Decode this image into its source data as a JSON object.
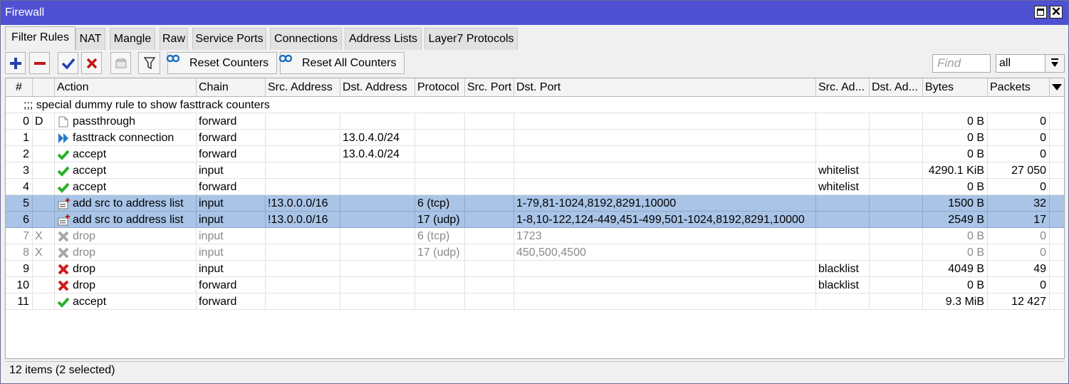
{
  "window": {
    "title": "Firewall"
  },
  "tabs": [
    "Filter Rules",
    "NAT",
    "Mangle",
    "Raw",
    "Service Ports",
    "Connections",
    "Address Lists",
    "Layer7 Protocols"
  ],
  "toolbar": {
    "reset_counters": "Reset Counters",
    "reset_all_counters": "Reset All Counters",
    "find_placeholder": "Find",
    "filter_value": "all"
  },
  "columns": [
    "#",
    "",
    "Action",
    "Chain",
    "Src. Address",
    "Dst. Address",
    "Protocol",
    "Src. Port",
    "Dst. Port",
    "Src. Ad...",
    "Dst. Ad...",
    "Bytes",
    "Packets"
  ],
  "comment": ";;; special dummy rule to show fasttrack counters",
  "rows": [
    {
      "num": "0",
      "flag": "D",
      "icon": "passthrough-icon",
      "action": "passthrough",
      "chain": "forward",
      "src": "",
      "dst": "",
      "proto": "",
      "sport": "",
      "dport": "",
      "srclist": "",
      "dstlist": "",
      "bytes": "0 B",
      "packets": "0",
      "state": "normal"
    },
    {
      "num": "1",
      "flag": "",
      "icon": "fasttrack-icon",
      "action": "fasttrack connection",
      "chain": "forward",
      "src": "",
      "dst": "13.0.4.0/24",
      "proto": "",
      "sport": "",
      "dport": "",
      "srclist": "",
      "dstlist": "",
      "bytes": "0 B",
      "packets": "0",
      "state": "normal"
    },
    {
      "num": "2",
      "flag": "",
      "icon": "accept-icon",
      "action": "accept",
      "chain": "forward",
      "src": "",
      "dst": "13.0.4.0/24",
      "proto": "",
      "sport": "",
      "dport": "",
      "srclist": "",
      "dstlist": "",
      "bytes": "0 B",
      "packets": "0",
      "state": "normal"
    },
    {
      "num": "3",
      "flag": "",
      "icon": "accept-icon",
      "action": "accept",
      "chain": "input",
      "src": "",
      "dst": "",
      "proto": "",
      "sport": "",
      "dport": "",
      "srclist": "whitelist",
      "dstlist": "",
      "bytes": "4290.1 KiB",
      "packets": "27 050",
      "state": "normal"
    },
    {
      "num": "4",
      "flag": "",
      "icon": "accept-icon",
      "action": "accept",
      "chain": "forward",
      "src": "",
      "dst": "",
      "proto": "",
      "sport": "",
      "dport": "",
      "srclist": "whitelist",
      "dstlist": "",
      "bytes": "0 B",
      "packets": "0",
      "state": "normal"
    },
    {
      "num": "5",
      "flag": "",
      "icon": "add-to-list-icon",
      "action": "add src to address list",
      "chain": "input",
      "src": "!13.0.0.0/16",
      "dst": "",
      "proto": "6 (tcp)",
      "sport": "",
      "dport": "1-79,81-1024,8192,8291,10000",
      "srclist": "",
      "dstlist": "",
      "bytes": "1500 B",
      "packets": "32",
      "state": "selected"
    },
    {
      "num": "6",
      "flag": "",
      "icon": "add-to-list-icon",
      "action": "add src to address list",
      "chain": "input",
      "src": "!13.0.0.0/16",
      "dst": "",
      "proto": "17 (udp)",
      "sport": "",
      "dport": "1-8,10-122,124-449,451-499,501-1024,8192,8291,10000",
      "srclist": "",
      "dstlist": "",
      "bytes": "2549 B",
      "packets": "17",
      "state": "selected"
    },
    {
      "num": "7",
      "flag": "X",
      "icon": "drop-disabled-icon",
      "action": "drop",
      "chain": "input",
      "src": "",
      "dst": "",
      "proto": "6 (tcp)",
      "sport": "",
      "dport": "1723",
      "srclist": "",
      "dstlist": "",
      "bytes": "0 B",
      "packets": "0",
      "state": "disabled"
    },
    {
      "num": "8",
      "flag": "X",
      "icon": "drop-disabled-icon",
      "action": "drop",
      "chain": "input",
      "src": "",
      "dst": "",
      "proto": "17 (udp)",
      "sport": "",
      "dport": "450,500,4500",
      "srclist": "",
      "dstlist": "",
      "bytes": "0 B",
      "packets": "0",
      "state": "disabled"
    },
    {
      "num": "9",
      "flag": "",
      "icon": "drop-icon",
      "action": "drop",
      "chain": "input",
      "src": "",
      "dst": "",
      "proto": "",
      "sport": "",
      "dport": "",
      "srclist": "blacklist",
      "dstlist": "",
      "bytes": "4049 B",
      "packets": "49",
      "state": "normal"
    },
    {
      "num": "10",
      "flag": "",
      "icon": "drop-icon",
      "action": "drop",
      "chain": "forward",
      "src": "",
      "dst": "",
      "proto": "",
      "sport": "",
      "dport": "",
      "srclist": "blacklist",
      "dstlist": "",
      "bytes": "0 B",
      "packets": "0",
      "state": "normal"
    },
    {
      "num": "11",
      "flag": "",
      "icon": "accept-icon",
      "action": "accept",
      "chain": "forward",
      "src": "",
      "dst": "",
      "proto": "",
      "sport": "",
      "dport": "",
      "srclist": "",
      "dstlist": "",
      "bytes": "9.3 MiB",
      "packets": "12 427",
      "state": "normal"
    }
  ],
  "status": "12 items (2 selected)",
  "colors": {
    "titlebar": "#5050d2",
    "selected_row": "#a9c4e6",
    "disabled_text": "#8a8a8a"
  }
}
